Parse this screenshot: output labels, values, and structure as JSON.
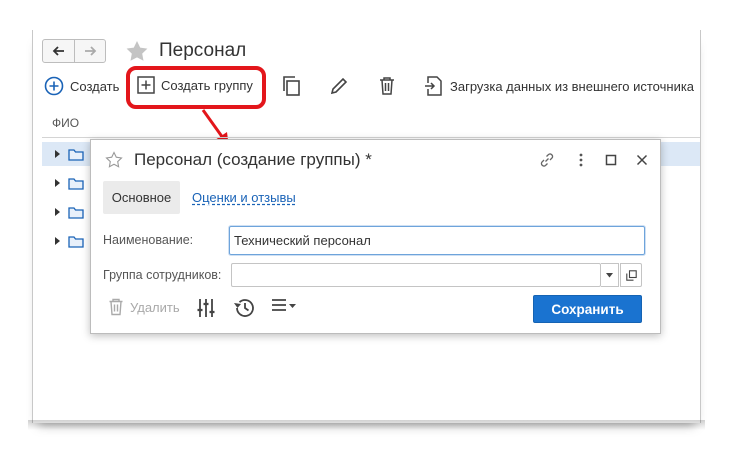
{
  "window": {
    "title": "Персонал"
  },
  "toolbar": {
    "create_label": "Создать",
    "create_group_label": "Создать группу",
    "import_label": "Загрузка данных из внешнего источника"
  },
  "list": {
    "column_header": "ФИО",
    "rows": [
      {
        "selected": true
      },
      {
        "selected": false
      },
      {
        "selected": false
      },
      {
        "selected": false
      }
    ]
  },
  "dialog": {
    "title": "Персонал (создание группы) *",
    "tabs": [
      {
        "label": "Основное",
        "active": true
      },
      {
        "label": "Оценки и отзывы",
        "active": false
      }
    ],
    "fields": {
      "name_label": "Наименование:",
      "name_value": "Технический персонал",
      "group_label": "Группа сотрудников:",
      "group_value": ""
    },
    "delete_label": "Удалить",
    "save_label": "Сохранить"
  },
  "colors": {
    "accent": "#1a73d0",
    "highlight": "#e3161b",
    "link": "#1a63b7",
    "selected_row": "#dce8f6"
  }
}
